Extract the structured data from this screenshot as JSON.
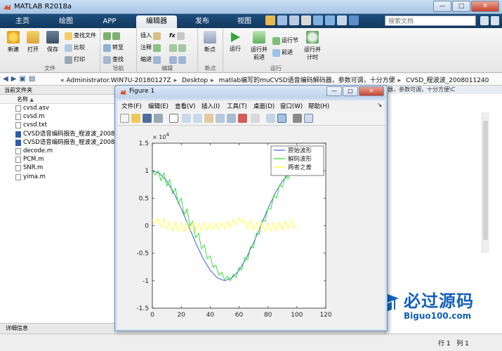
{
  "window": {
    "title": "MATLAB R2018a",
    "minimize": "—",
    "maximize": "□",
    "close": "✕"
  },
  "ribbon_tabs": [
    {
      "label": "主页"
    },
    {
      "label": "绘图"
    },
    {
      "label": "APP"
    },
    {
      "label": "编辑器"
    },
    {
      "label": "发布"
    },
    {
      "label": "视图"
    }
  ],
  "search": {
    "placeholder": "搜索文档"
  },
  "ribbon": {
    "file": {
      "new": "新建",
      "open": "打开",
      "save": "保存",
      "find_files": "查找文件",
      "compare": "比较",
      "print": "打印",
      "group": "文件"
    },
    "navigate": {
      "goto": "转至",
      "find": "查找",
      "group": "导航"
    },
    "edit": {
      "insert": "插入",
      "comment": "注释",
      "indent": "缩进",
      "fx": "fx",
      "group": "编辑"
    },
    "breakpoints": {
      "label": "断点",
      "group": "断点"
    },
    "run": {
      "run": "运行",
      "run_advance": "运行并前进",
      "run_section": "运行节",
      "advance": "前进",
      "run_time": "运行并计时",
      "group": "运行"
    }
  },
  "address": {
    "prefix": "«",
    "segments": [
      "Administrator.WIN7U-20180127Z",
      "Desktop",
      "matlab编写的muCVSD语音编码解码器，参数可调，十分方便",
      "CVSD_程波波_2008011240"
    ]
  },
  "file_panel": {
    "header": "当前文件夹",
    "col_name": "名称",
    "sort_arrow": "▲",
    "files": [
      "cvsd.asv",
      "cvsd.m",
      "cvsd.txt",
      "CVSD语音编码报告_程波波_2008011240",
      "CVSD语音编码报告_程波波_2008011240",
      "decode.m",
      "PCM.m",
      "SNR.m",
      "yima.m"
    ]
  },
  "details": {
    "label": "详细信息"
  },
  "right_panel": {
    "path_text": "器，参数可调，十分方便\\C",
    "up_arrow": "▲"
  },
  "statusbar": {
    "row_label": "行",
    "row": "1",
    "col_label": "列",
    "col": "1"
  },
  "watermark": {
    "brand": "必过源码",
    "domain": "Biguo100.com"
  },
  "figure": {
    "title": "Figure 1",
    "menu": [
      "文件(F)",
      "编辑(E)",
      "查看(V)",
      "插入(I)",
      "工具(T)",
      "桌面(D)",
      "窗口(W)",
      "帮助(H)"
    ],
    "menu_arrow": "↘"
  },
  "colors": {
    "ribbon_dark": "#1c4e7e",
    "original": "#3c5ee0",
    "decoded": "#22dd22",
    "difference": "#ffff33"
  },
  "chart_data": {
    "type": "line",
    "exponent_label": "× 10^4",
    "exponent_base": "× 10",
    "exponent_power": "4",
    "xlim": [
      0,
      120
    ],
    "ylim": [
      -1.5,
      1.5
    ],
    "x_ticks": [
      "0",
      "20",
      "40",
      "60",
      "80",
      "100",
      "120"
    ],
    "y_ticks": [
      "1.5",
      "1",
      "0.5",
      "0",
      "-0.5",
      "-1",
      "-1.5"
    ],
    "legend_position": "top-right",
    "legend": [
      "原始波形",
      "解码波形",
      "两者之差"
    ],
    "series": [
      {
        "name": "原始波形",
        "color": "#3c5ee0",
        "x": [
          0,
          5,
          10,
          15,
          20,
          25,
          30,
          35,
          40,
          45,
          50,
          55,
          60,
          65,
          70,
          75,
          80,
          85,
          90,
          95,
          100
        ],
        "y": [
          1.0,
          0.95,
          0.81,
          0.59,
          0.31,
          0.0,
          -0.31,
          -0.59,
          -0.81,
          -0.95,
          -1.0,
          -0.95,
          -0.81,
          -0.59,
          -0.31,
          0.0,
          0.31,
          0.59,
          0.81,
          0.95,
          1.0
        ]
      },
      {
        "name": "解码波形",
        "color": "#22dd22",
        "x": [
          0,
          2,
          4,
          6,
          8,
          10,
          12,
          14,
          16,
          18,
          20,
          22,
          24,
          26,
          28,
          30,
          32,
          34,
          36,
          38,
          40,
          42,
          44,
          46,
          48,
          50,
          52,
          54,
          56,
          58,
          60,
          62,
          64,
          66,
          68,
          70,
          72,
          74,
          76,
          78,
          80,
          82,
          84,
          86,
          88,
          90,
          92,
          94,
          96,
          98,
          100
        ],
        "y": [
          1.0,
          0.92,
          1.0,
          0.82,
          0.96,
          0.72,
          0.84,
          0.58,
          0.68,
          0.4,
          0.5,
          0.2,
          0.3,
          0.0,
          0.08,
          -0.22,
          -0.14,
          -0.42,
          -0.35,
          -0.6,
          -0.55,
          -0.76,
          -0.72,
          -0.9,
          -0.85,
          -0.98,
          -0.92,
          -1.0,
          -0.88,
          -0.94,
          -0.76,
          -0.8,
          -0.58,
          -0.62,
          -0.38,
          -0.4,
          -0.14,
          -0.16,
          0.1,
          0.08,
          0.32,
          0.3,
          0.55,
          0.5,
          0.74,
          0.7,
          0.9,
          0.85,
          1.0,
          0.92,
          1.0
        ]
      },
      {
        "name": "两者之差",
        "color": "#ffff33",
        "x": [
          0,
          2,
          4,
          6,
          8,
          10,
          12,
          14,
          16,
          18,
          20,
          22,
          24,
          26,
          28,
          30,
          32,
          34,
          36,
          38,
          40,
          42,
          44,
          46,
          48,
          50,
          52,
          54,
          56,
          58,
          60,
          62,
          64,
          66,
          68,
          70,
          72,
          74,
          76,
          78,
          80,
          82,
          84,
          86,
          88,
          90,
          92,
          94,
          96,
          98,
          100
        ],
        "y": [
          0.1,
          0.03,
          0.14,
          -0.02,
          0.12,
          -0.06,
          0.08,
          -0.1,
          0.06,
          -0.1,
          0.06,
          -0.11,
          0.05,
          -0.1,
          0.06,
          -0.1,
          0.05,
          -0.1,
          0.06,
          -0.08,
          0.05,
          -0.07,
          0.05,
          -0.07,
          0.06,
          -0.06,
          0.08,
          -0.04,
          0.12,
          0.02,
          0.15,
          0.06,
          0.08,
          -0.05,
          0.1,
          -0.08,
          0.06,
          -0.1,
          0.06,
          -0.1,
          0.05,
          -0.1,
          0.06,
          -0.09,
          0.06,
          -0.08,
          0.08,
          -0.06,
          0.1,
          -0.03,
          0.0
        ]
      }
    ]
  }
}
